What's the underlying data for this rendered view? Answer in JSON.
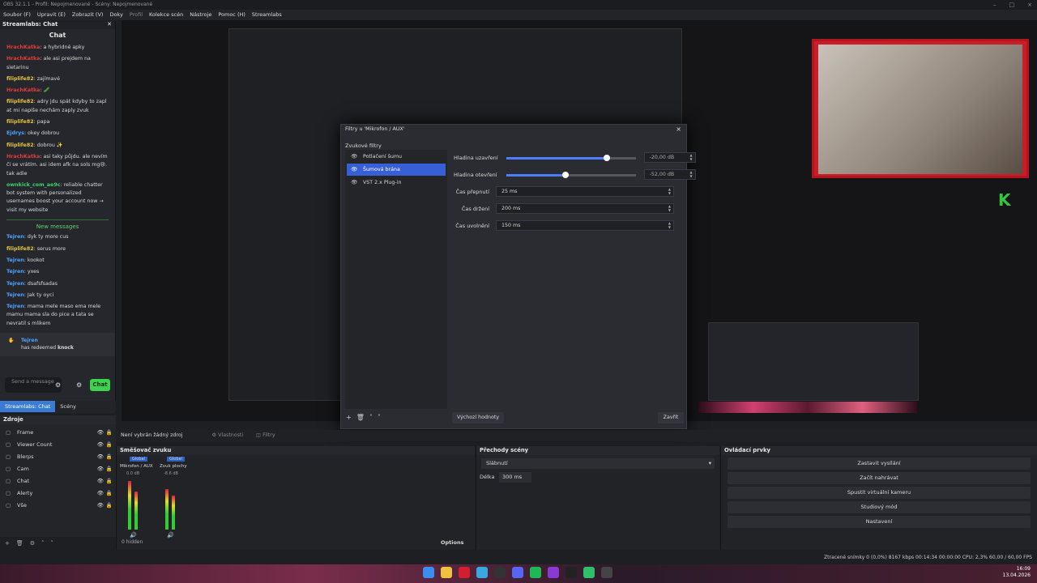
{
  "window": {
    "title": "OBS 32.1.1 - Profil: Nepojmenované - Scény: Nepojmenované",
    "controls": [
      "–",
      "□",
      "×"
    ]
  },
  "menu": [
    "Soubor (F)",
    "Upravit (E)",
    "Zobrazit (V)",
    "Doky",
    "Profil",
    "Kolekce scén",
    "Nástroje",
    "Pomoc (H)",
    "Streamlabs"
  ],
  "chat": {
    "dock_title": "Streamlabs: Chat",
    "title": "Chat",
    "messages": [
      {
        "user": "HrachKatka",
        "text": "a hybridné apky",
        "color": "#e23b3b"
      },
      {
        "user": "HrachKatka",
        "text": "ale asi prejdem na sietarinu",
        "color": "#e23b3b"
      },
      {
        "user": "filiplife82",
        "text": "zajímavé",
        "color": "#e3c53b"
      },
      {
        "user": "HrachKatka",
        "text": "🥒",
        "color": "#e23b3b"
      },
      {
        "user": "filiplife82",
        "text": "adry jdu spát kdyby to zapl at mi napíše nechám zaply zvuk",
        "color": "#e3c53b"
      },
      {
        "user": "filiplife82",
        "text": "papa",
        "color": "#e3c53b"
      },
      {
        "user": "Ejdrys",
        "text": "okey dobrou",
        "color": "#4aa3ff"
      },
      {
        "user": "filiplife82",
        "text": "dobrou ✨",
        "color": "#e3c53b"
      },
      {
        "user": "HrachKatka",
        "text": "asi taky půjdu. ale nevím či se vrátím. asi idem afk na sols mg😢. tak adie",
        "color": "#e23b3b"
      },
      {
        "user": "ownkick_com_ae9c",
        "text": "reliable chatter bot system with personalized usernames boost your account now → visit my website",
        "color": "#3bd36b"
      }
    ],
    "new_messages_label": "New messages",
    "new": [
      {
        "user": "Tejren",
        "text": "dyk ty more cus"
      },
      {
        "user": "filiplife82",
        "text": "serus more"
      },
      {
        "user": "Tejren",
        "text": "kookot"
      },
      {
        "user": "Tejren",
        "text": "yxes"
      },
      {
        "user": "Tejren",
        "text": "dsafsfsadas"
      },
      {
        "user": "Tejren",
        "text": "Jak ty oyci"
      },
      {
        "user": "Tejren",
        "text": "mama mele maso ema mele mamu mama sla do pice a tata se nevratil s mlikem"
      }
    ],
    "redeem_user": "Tejren",
    "redeem_text": "has redeemed",
    "redeem_item": "knock",
    "send_placeholder": "Send a message",
    "chat_button": "Chat"
  },
  "dock_tabs": [
    "Streamlabs: Chat",
    "Scény"
  ],
  "sources": {
    "title": "Zdroje",
    "items": [
      "Frame",
      "Viewer Count",
      "Blerps",
      "Cam",
      "Chat",
      "Alerty",
      "Vše"
    ]
  },
  "preview_bar": {
    "no_source": "Není vybrán žádný zdroj",
    "props": "Vlastnosti",
    "filters": "Filtry"
  },
  "mixer": {
    "title": "Směšovač zvuku",
    "ch1": "Mikrofon / AUX",
    "ch2": "Zvuk plochy",
    "global": "Global",
    "db1": "0.0 dB",
    "db2": "-8.6 dB",
    "hidden": "0 hidden",
    "options": "Options"
  },
  "transitions": {
    "title": "Přechody scény",
    "type": "Slábnutí",
    "duration_label": "Délka",
    "duration": "300 ms"
  },
  "controls": {
    "title": "Ovládací prvky",
    "buttons": [
      "Zastavit vysílání",
      "Začít nahrávat",
      "Spustit virtuální kameru",
      "Studiový mód",
      "Nastavení"
    ]
  },
  "dialog": {
    "title": "Filtry u 'Mikrofon / AUX'",
    "section": "Zvukové filtry",
    "filters": [
      "Potlačení šumu",
      "Šumová brána",
      "VST 2.x Plug-in"
    ],
    "params": [
      {
        "label": "Hladina uzavření",
        "value": "-20,00 dB",
        "fill": 0.78
      },
      {
        "label": "Hladina otevření",
        "value": "-52,00 dB",
        "fill": 0.46
      },
      {
        "label": "Čas přepnutí",
        "value": "25 ms"
      },
      {
        "label": "Čas držení",
        "value": "200 ms"
      },
      {
        "label": "Čas uvolnění",
        "value": "150 ms"
      }
    ],
    "defaults": "Výchozí hodnoty",
    "close": "Zavřít"
  },
  "status": {
    "text": "Ztracené snímky 0 (0,0%)   8167 kbps   00:14:34   00:00:00   CPU: 2,3%   60,00 / 60,00 FPS"
  },
  "clock": {
    "time": "16:09",
    "date": "13.04.2026"
  }
}
